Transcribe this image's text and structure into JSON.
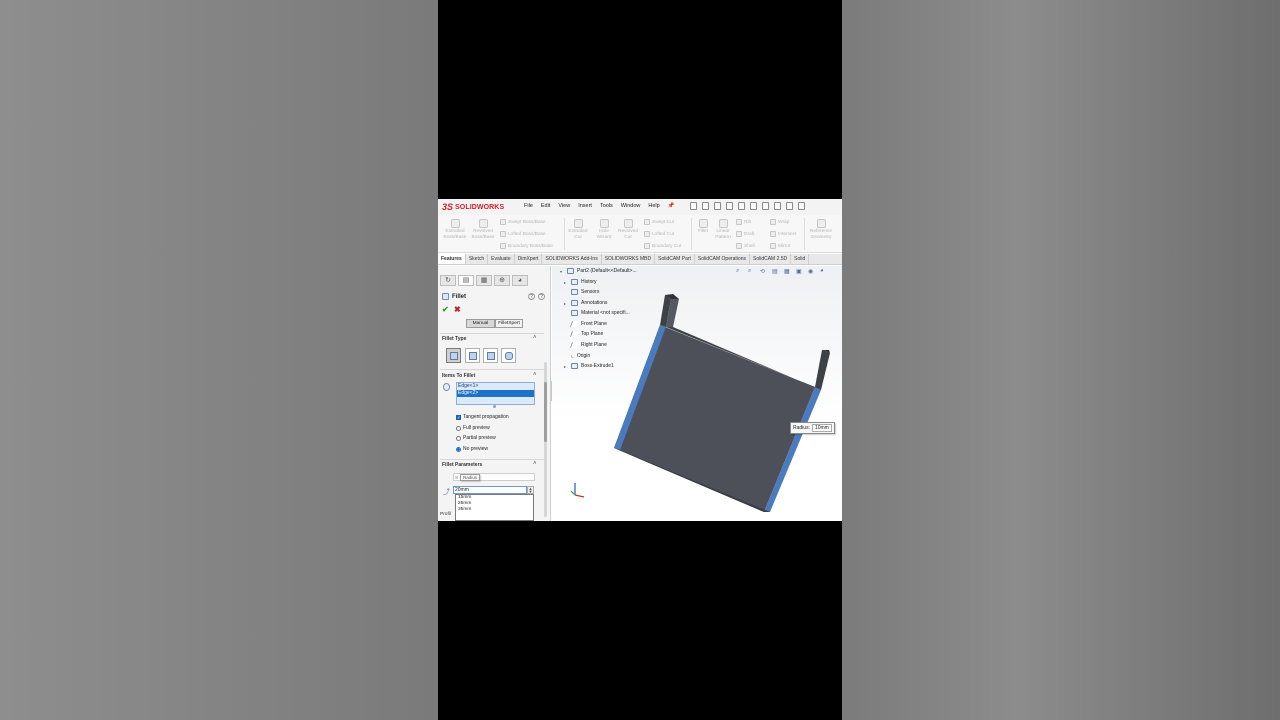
{
  "app": {
    "logo_ds": "3S",
    "logo_text": "SOLIDWORKS",
    "accent_color": "#d0202e"
  },
  "menu": [
    "File",
    "Edit",
    "View",
    "Insert",
    "Tools",
    "Window",
    "Help"
  ],
  "commands": {
    "extruded_boss": "Extruded Boss/Base",
    "revolved_boss": "Revolved Boss/Base",
    "swept_boss": "Swept Boss/Base",
    "lofted_boss": "Lofted Boss/Base",
    "boundary_boss": "Boundary Boss/Base",
    "extruded_cut": "Extruded Cut",
    "hole_wizard": "Hole Wizard",
    "revolved_cut": "Revolved Cut",
    "swept_cut": "Swept Cut",
    "lofted_cut": "Lofted Cut",
    "boundary_cut": "Boundary Cut",
    "fillet": "Fillet",
    "linear_pattern": "Linear Pattern",
    "rib": "Rib",
    "draft": "Draft",
    "shell": "Shell",
    "wrap": "Wrap",
    "intersect": "Intersect",
    "mirror": "Mirror",
    "reference_geometry": "Reference Geometry"
  },
  "tabs": [
    "Features",
    "Sketch",
    "Evaluate",
    "DimXpert",
    "SOLIDWORKS Add-Ins",
    "SOLIDWORKS MBD",
    "SolidCAM Part",
    "SolidCAM Operations",
    "SolidCAM 2.5D",
    "Solid"
  ],
  "property_manager": {
    "title": "Fillet",
    "help": "?",
    "manual_tab": "Manual",
    "filletxpert_tab": "FilletXpert",
    "fillet_type_title": "Fillet Type",
    "items_title": "Items To Fillet",
    "edges": [
      "Edge<1>",
      "Edge<2>"
    ],
    "tangent_propagation": "Tangent propagation",
    "full_preview": "Full preview",
    "partial_preview": "Partial preview",
    "no_preview": "No preview",
    "params_title": "Fillet Parameters",
    "tooltip": "Radius",
    "radius_value": "20mm",
    "radius_options": [
      "15mm",
      "25mm",
      "35mm"
    ],
    "profile_label": "Profil"
  },
  "tree": {
    "root": "Part2 (Default<<Default>...",
    "items": [
      "History",
      "Sensors",
      "Annotations",
      "Material <not specifi...",
      "Front Plane",
      "Top Plane",
      "Right Plane",
      "Origin",
      "Boss-Extrude1"
    ]
  },
  "callout": {
    "label": "Radius:",
    "value": "10mm"
  }
}
